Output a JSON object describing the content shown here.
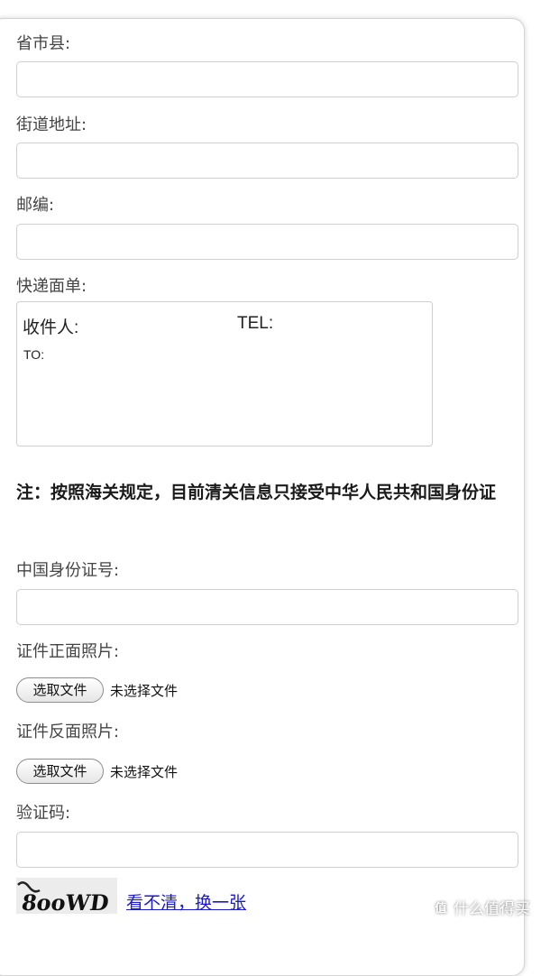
{
  "form": {
    "province_label": "省市县:",
    "street_label": "街道地址:",
    "zip_label": "邮编:",
    "waybill_label": "快递面单:",
    "id_number_label": "中国身份证号:",
    "id_front_label": "证件正面照片:",
    "id_back_label": "证件反面照片:",
    "captcha_label": "验证码:"
  },
  "waybill": {
    "recipient_label": "收件人:",
    "tel_label": "TEL:",
    "to_label": "TO:"
  },
  "notice": "注：按照海关规定，目前清关信息只接受中华人民共和国身份证",
  "file_upload": {
    "button_label": "选取文件",
    "status": "未选择文件"
  },
  "captcha": {
    "image_text": "8ooWD",
    "refresh_link": "看不清，换一张"
  },
  "watermark": {
    "icon": "值",
    "text": "什么值得买"
  }
}
